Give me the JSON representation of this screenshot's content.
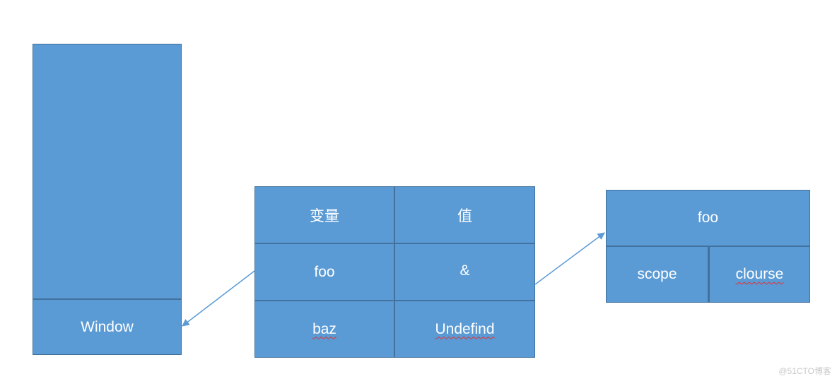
{
  "window_stack": {
    "label": "Window"
  },
  "variable_table": {
    "headers": [
      "变量",
      "值"
    ],
    "rows": [
      {
        "name": "foo",
        "value": "&",
        "name_misspelled": false,
        "value_misspelled": false
      },
      {
        "name": "baz",
        "value": "Undefind",
        "name_misspelled": true,
        "value_misspelled": true
      }
    ]
  },
  "function_object": {
    "title": "foo",
    "parts": [
      {
        "label": "scope",
        "misspelled": false
      },
      {
        "label": "clourse",
        "misspelled": true
      }
    ]
  },
  "arrows": [
    {
      "from": "variable_table",
      "to": "window_stack"
    },
    {
      "from": "variable_table.foo",
      "to": "function_object"
    }
  ],
  "colors": {
    "box_fill": "#5b9bd5",
    "box_border": "#41719c",
    "arrow": "#5b9bd5",
    "spellcheck": "#e03030"
  },
  "watermark": "@51CTO博客"
}
